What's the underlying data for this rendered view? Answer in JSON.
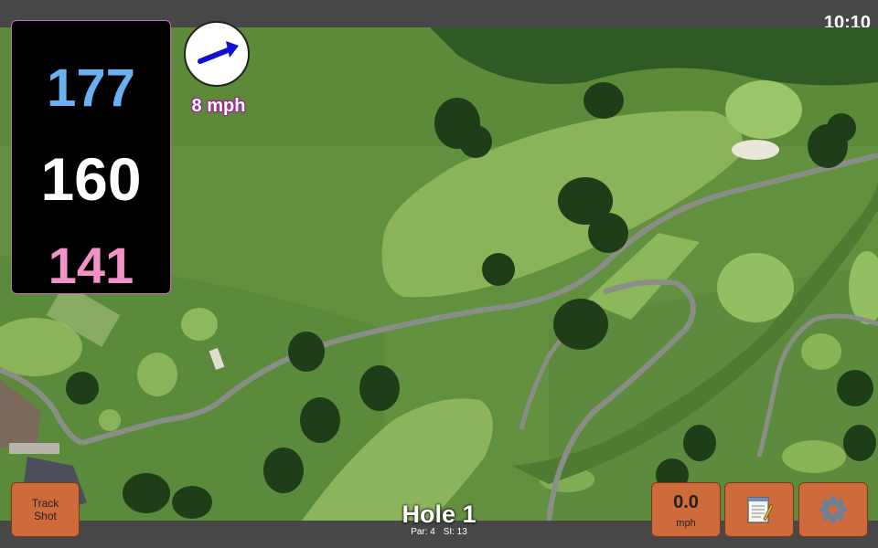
{
  "status_bar": {
    "time": "10:10"
  },
  "distances": {
    "back": "177",
    "middle": "160",
    "front": "141"
  },
  "wind": {
    "speed_label": "8 mph",
    "direction_icon": "arrow-right-icon"
  },
  "buttons": {
    "track_shot_line1": "Track",
    "track_shot_line2": "Shot",
    "speed_value": "0.0",
    "speed_unit": "mph",
    "notes_icon": "notepad-icon",
    "settings_icon": "gear-icon"
  },
  "hole": {
    "title": "Hole 1",
    "par": "Par: 4",
    "si": "SI: 13"
  },
  "colors": {
    "back": "#6bb0f2",
    "middle": "#ffffff",
    "front": "#f292c8",
    "button": "#cf6a3a",
    "wind_arrow": "#1010d0"
  },
  "map": {
    "type": "satellite-aerial-golf-course"
  }
}
